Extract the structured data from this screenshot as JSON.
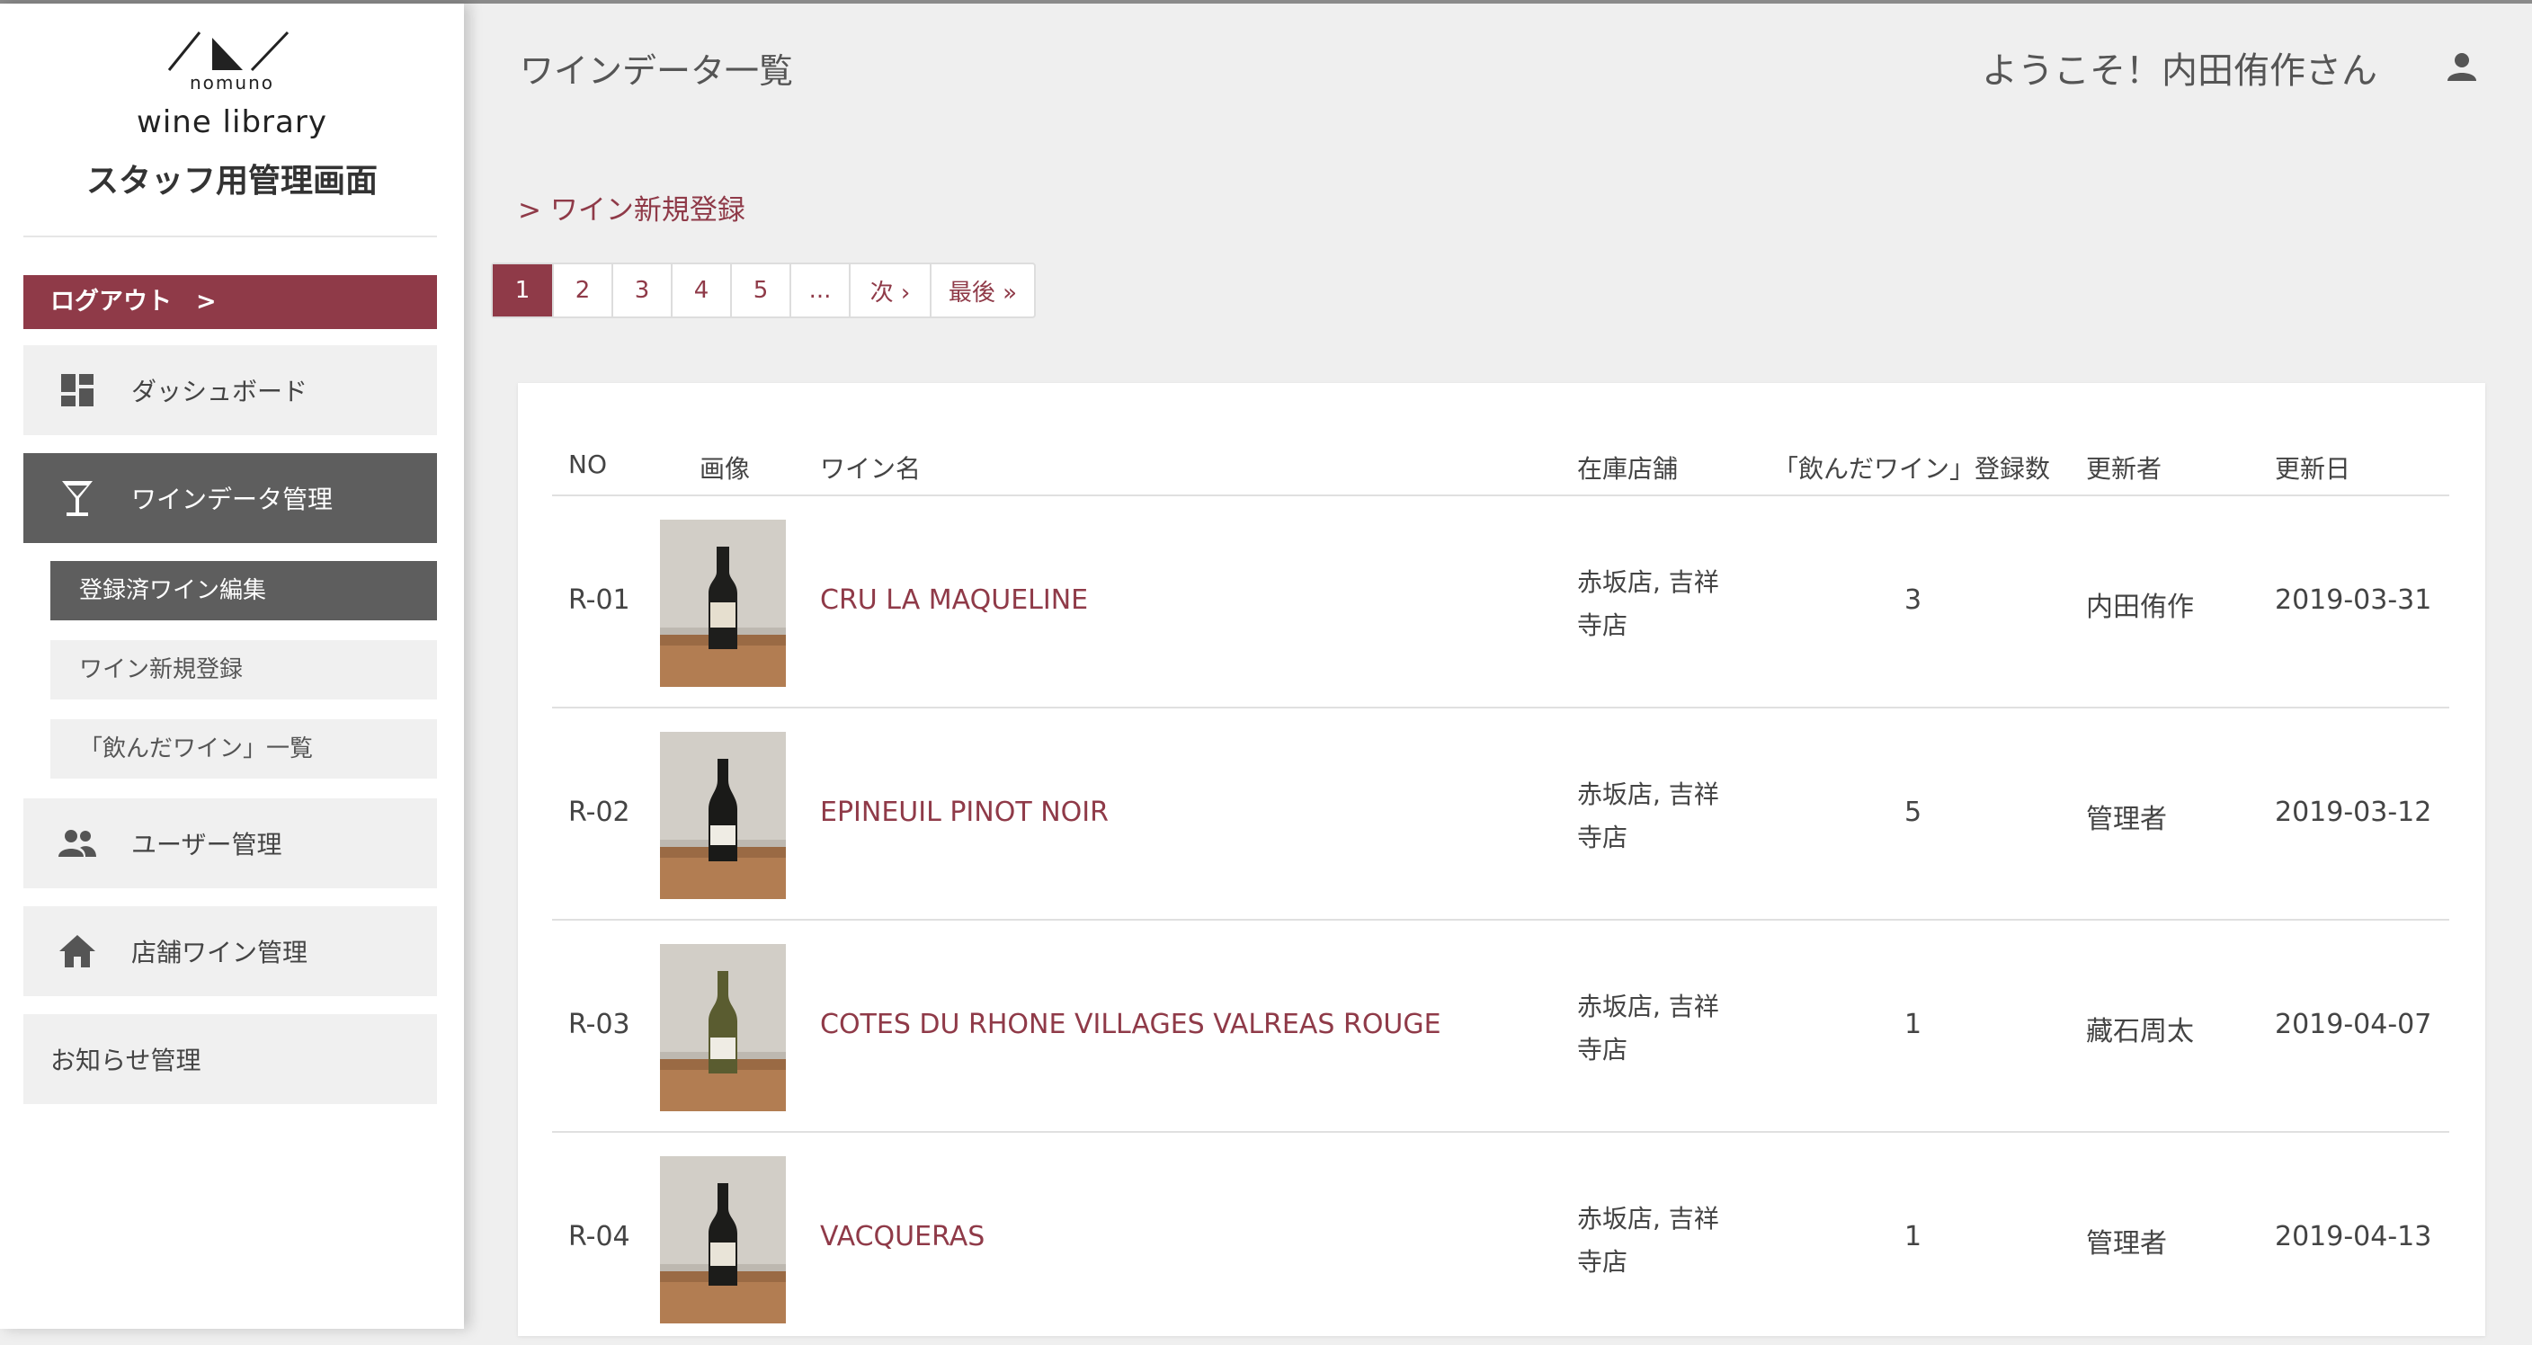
{
  "brand": {
    "name_small": "nomuno",
    "name": "wine library",
    "subtitle": "スタッフ用管理画面"
  },
  "sidebar": {
    "logout": "ログアウト　>",
    "items": [
      {
        "label": "ダッシュボード",
        "icon": "dashboard-icon"
      },
      {
        "label": "ワインデータ管理",
        "icon": "wine-glass-icon"
      },
      {
        "label": "ユーザー管理",
        "icon": "users-icon"
      },
      {
        "label": "店舗ワイン管理",
        "icon": "home-icon"
      },
      {
        "label": "お知らせ管理"
      }
    ],
    "subitems": [
      {
        "label": "登録済ワイン編集"
      },
      {
        "label": "ワイン新規登録"
      },
      {
        "label": "「飲んだワイン」一覧"
      }
    ]
  },
  "header": {
    "title": "ワインデータ一覧",
    "welcome": "ようこそ！内田侑作さん",
    "user_icon": "person-icon"
  },
  "new_link": "> ワイン新規登録",
  "pagination": [
    "1",
    "2",
    "3",
    "4",
    "5",
    "...",
    "次 ›",
    "最後 »"
  ],
  "pagination_active": "1",
  "table": {
    "columns": [
      "NO",
      "画像",
      "ワイン名",
      "在庫店舗",
      "「飲んだワイン」登録数",
      "更新者",
      "更新日"
    ],
    "rows": [
      {
        "no": "R-01",
        "name": "CRU LA MAQUELINE",
        "store": "赤坂店, 吉祥寺店",
        "count": "3",
        "updater": "内田侑作",
        "date": "2019-03-31"
      },
      {
        "no": "R-02",
        "name": "EPINEUIL PINOT NOIR",
        "store": "赤坂店, 吉祥寺店",
        "count": "5",
        "updater": "管理者",
        "date": "2019-03-12"
      },
      {
        "no": "R-03",
        "name": "COTES DU RHONE VILLAGES VALREAS ROUGE",
        "store": "赤坂店, 吉祥寺店",
        "count": "1",
        "updater": "藏石周太",
        "date": "2019-04-07"
      },
      {
        "no": "R-04",
        "name": "VACQUERAS",
        "store": "赤坂店, 吉祥寺店",
        "count": "1",
        "updater": "管理者",
        "date": "2019-04-13"
      }
    ]
  },
  "colors": {
    "accent": "#8f3a48",
    "sidebar_active": "#5e5e5e",
    "background": "#efefef"
  }
}
